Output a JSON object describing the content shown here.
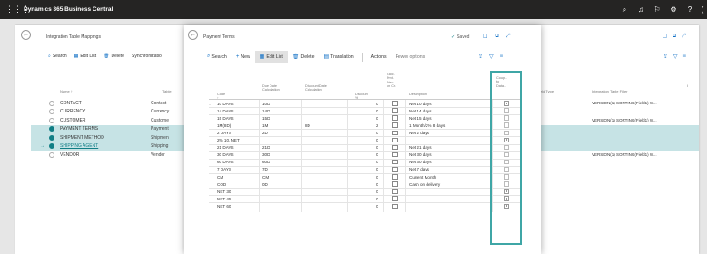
{
  "app": {
    "title": "Dynamics 365 Business Central"
  },
  "topbar_icons": [
    "search-icon",
    "bell-icon",
    "flag-icon",
    "gear-icon",
    "help-icon"
  ],
  "background_page": {
    "title": "Integration Table Mappings",
    "actions": [
      "Search",
      "Edit List",
      "Delete",
      "Synchronizatio"
    ],
    "columns": {
      "name": "Name ↑",
      "table": "Table",
      "right1": "eld Type",
      "right2": "Integration Table Filter",
      "right3": "I"
    },
    "rows": [
      {
        "name": "CONTACT",
        "table": "Contact",
        "filter": "VERSION(1) SORTING(Field1) W..."
      },
      {
        "name": "CURRENCY",
        "table": "Currency",
        "filter": ""
      },
      {
        "name": "CUSTOMER",
        "table": "Custome",
        "filter": "VERSION(1) SORTING(Field1) W..."
      },
      {
        "name": "PAYMENT TERMS",
        "table": "Payment",
        "filter": ""
      },
      {
        "name": "SHIPMENT METHOD",
        "table": "Shipmen",
        "filter": ""
      },
      {
        "name": "SHIPPING AGENT",
        "table": "Shipping",
        "filter": ""
      },
      {
        "name": "VENDOR",
        "table": "Vendor",
        "filter": "VERSION(1) SORTING(Field1) W..."
      }
    ]
  },
  "modal": {
    "title": "Payment Terms",
    "saved": "Saved",
    "actions": {
      "search": "Search",
      "new": "New",
      "edit_list": "Edit List",
      "delete": "Delete",
      "translation": "Translation",
      "actions": "Actions",
      "fewer": "Fewer options"
    },
    "columns": {
      "code": "Code ↑",
      "due": "Due Date\nCalculation",
      "disc_calc": "Discount Date\nCalculation",
      "disc_pct": "Discount %",
      "calc": "Calc.\nPmt.\nDisc.\non Cr.",
      "desc": "Description",
      "coupled": "Coup...\nto\nData..."
    },
    "rows": [
      {
        "code": "10 DAYS",
        "due": "10D",
        "disc": "",
        "pct": "0",
        "desc": "Net 10 days",
        "coupled": true,
        "current": true
      },
      {
        "code": "14 DAYS",
        "due": "14D",
        "disc": "",
        "pct": "0",
        "desc": "Net 14 days",
        "coupled": false
      },
      {
        "code": "15 DAYS",
        "due": "15D",
        "disc": "",
        "pct": "0",
        "desc": "Net 15 days",
        "coupled": false
      },
      {
        "code": "1M(8D)",
        "due": "1M",
        "disc": "8D",
        "pct": "2",
        "desc": "1 Month/2% 8 days",
        "coupled": false
      },
      {
        "code": "2 DAYS",
        "due": "2D",
        "disc": "",
        "pct": "0",
        "desc": "Net 2 days",
        "coupled": false
      },
      {
        "code": "2% 10, NET",
        "due": "",
        "disc": "",
        "pct": "0",
        "desc": "",
        "coupled": true
      },
      {
        "code": "21 DAYS",
        "due": "21D",
        "disc": "",
        "pct": "0",
        "desc": "Net 21 days",
        "coupled": false
      },
      {
        "code": "30 DAYS",
        "due": "30D",
        "disc": "",
        "pct": "0",
        "desc": "Net 30 days",
        "coupled": false
      },
      {
        "code": "60 DAYS",
        "due": "60D",
        "disc": "",
        "pct": "0",
        "desc": "Net 60 days",
        "coupled": false
      },
      {
        "code": "7 DAYS",
        "due": "7D",
        "disc": "",
        "pct": "0",
        "desc": "Net 7 days",
        "coupled": false
      },
      {
        "code": "CM",
        "due": "CM",
        "disc": "",
        "pct": "0",
        "desc": "Current Month",
        "coupled": false
      },
      {
        "code": "COD",
        "due": "0D",
        "disc": "",
        "pct": "0",
        "desc": "Cash on delivery",
        "coupled": false
      },
      {
        "code": "NET 30",
        "due": "",
        "disc": "",
        "pct": "0",
        "desc": "",
        "coupled": true
      },
      {
        "code": "NET 45",
        "due": "",
        "disc": "",
        "pct": "0",
        "desc": "",
        "coupled": true
      },
      {
        "code": "NET 60",
        "due": "",
        "disc": "",
        "pct": "0",
        "desc": "",
        "coupled": true
      }
    ]
  },
  "colors": {
    "topbar": "#252423",
    "accent": "#117e85",
    "highlight": "#3fa6a6",
    "selected_row": "#c6e3e5"
  }
}
